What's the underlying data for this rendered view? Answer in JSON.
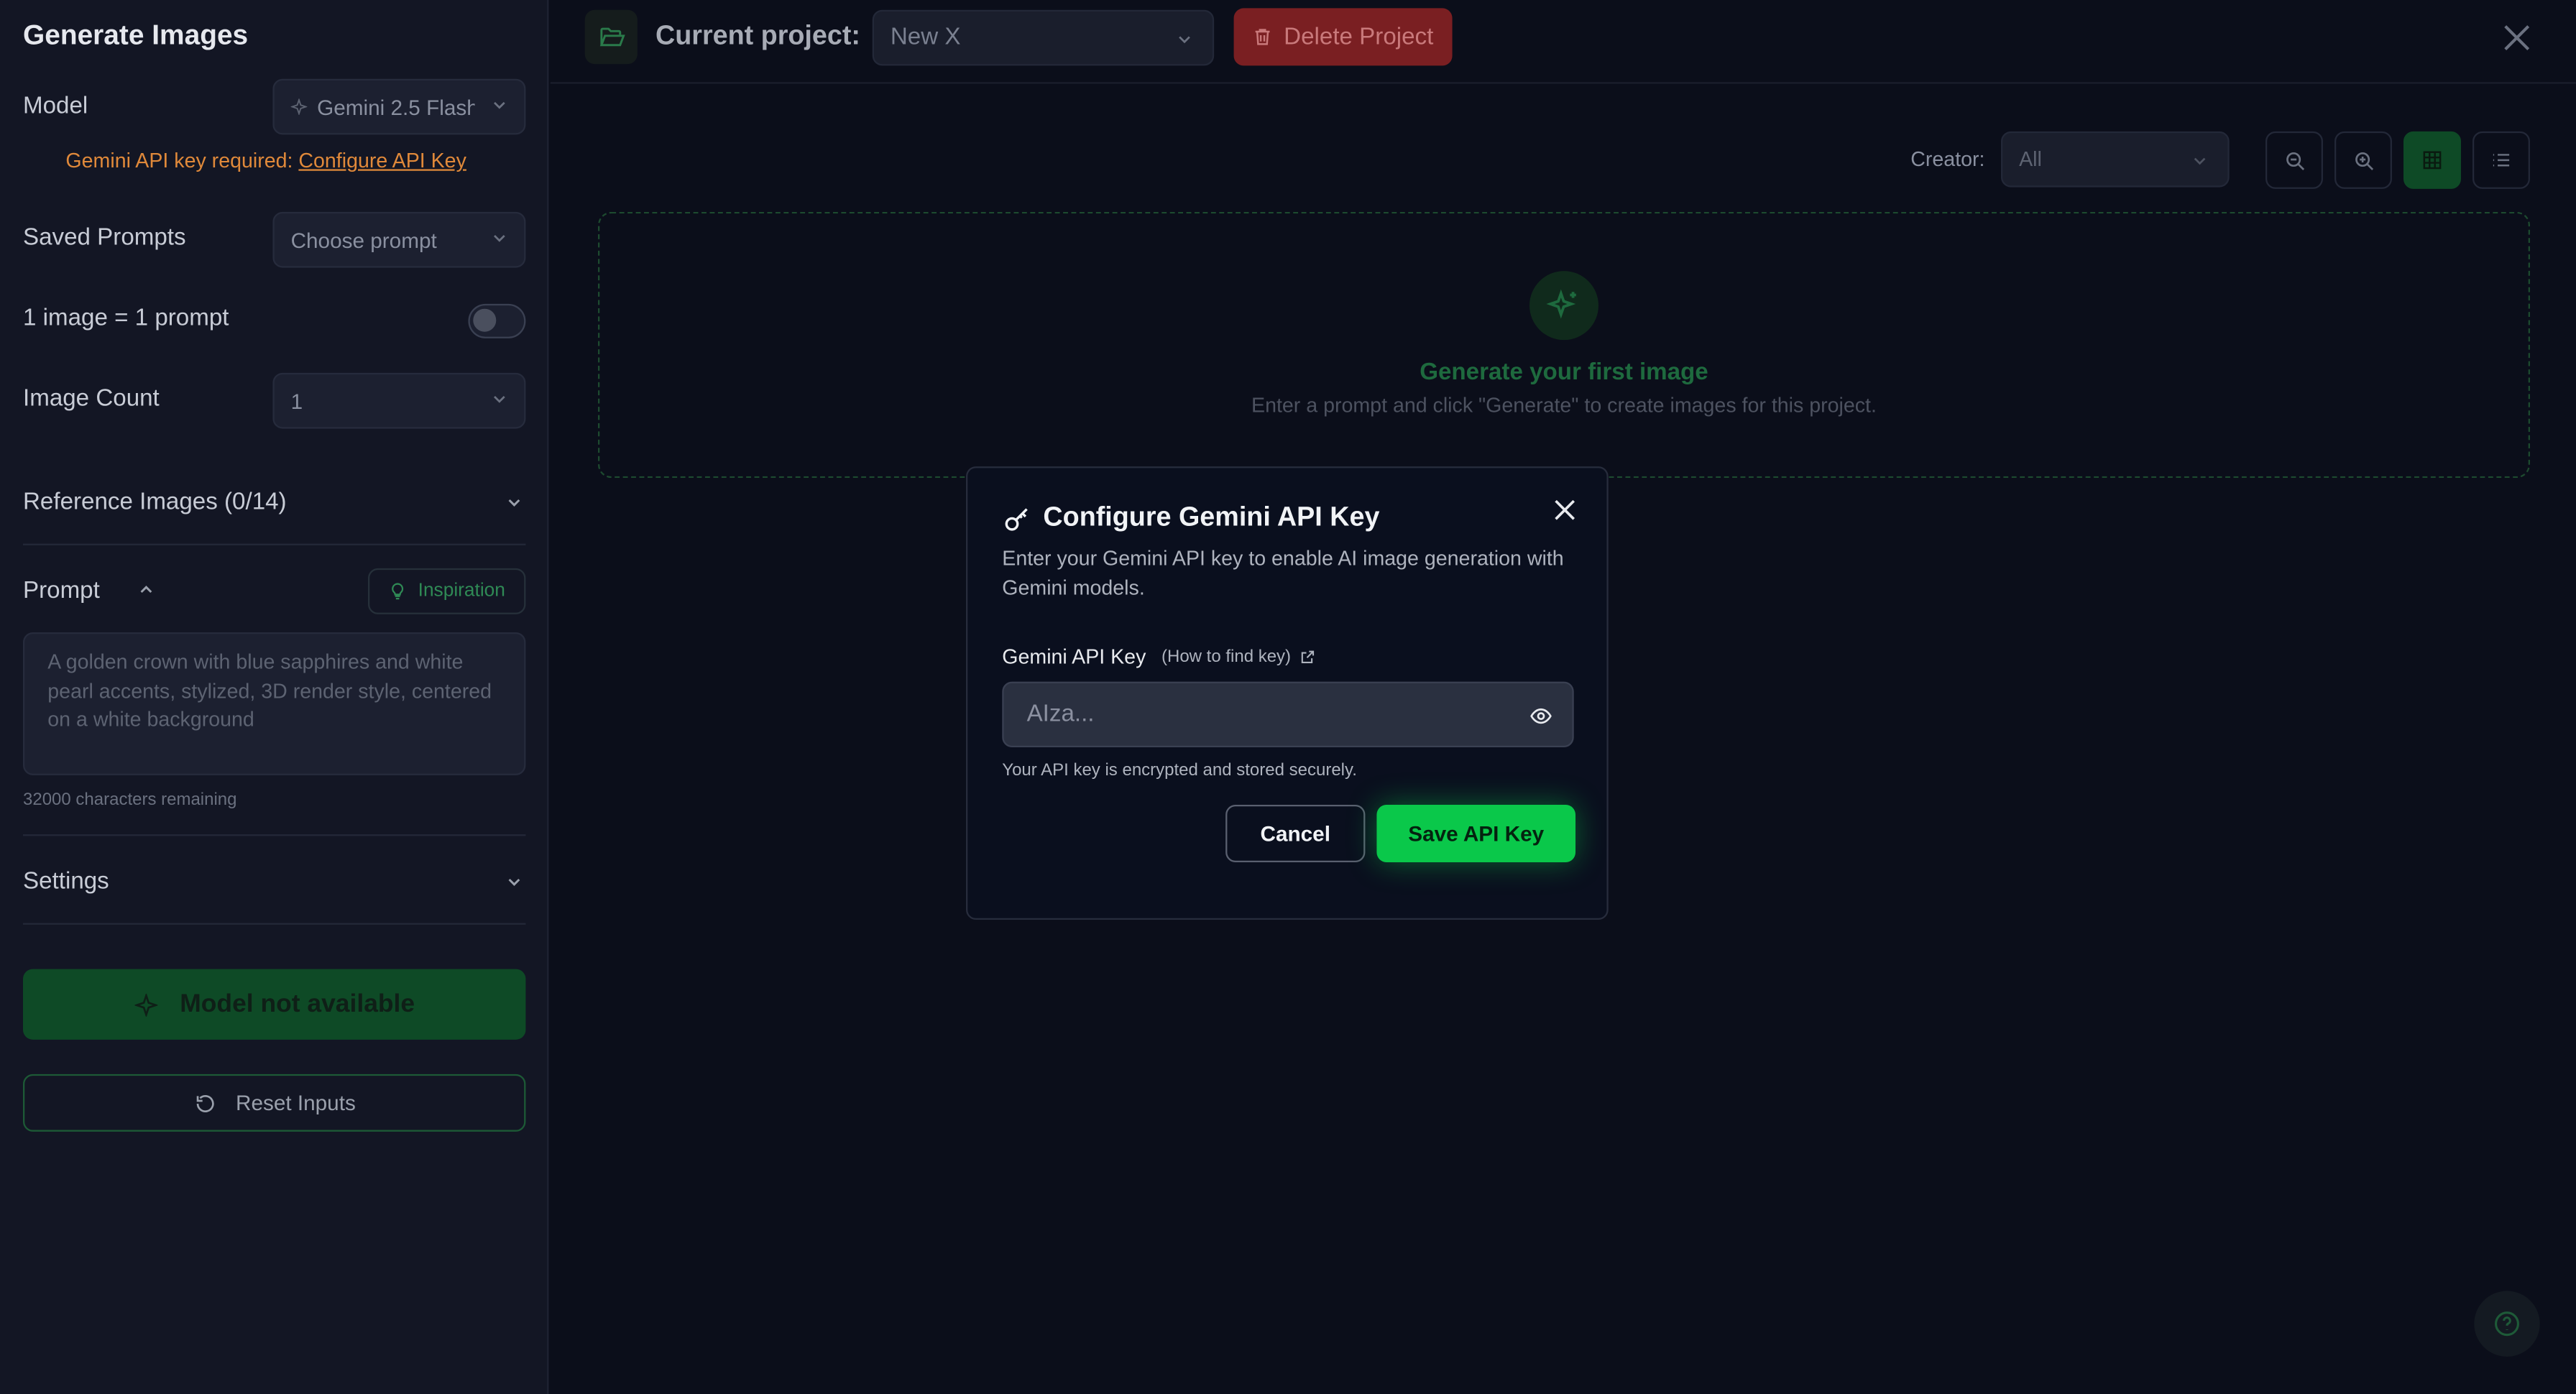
{
  "sidebar": {
    "title": "Generate Images",
    "model_label": "Model",
    "model_value": "Gemini 2.5 Flash",
    "warning_prefix": "Gemini API key required: ",
    "warning_link": "Configure API Key",
    "saved_prompts_label": "Saved Prompts",
    "saved_prompts_placeholder": "Choose prompt",
    "one_image_label": "1 image = 1 prompt",
    "image_count_label": "Image Count",
    "image_count_value": "1",
    "reference_images_label": "Reference Images (0/14)",
    "prompt_label": "Prompt",
    "inspiration_label": "Inspiration",
    "prompt_placeholder": "A golden crown with blue sapphires and white pearl accents, stylized, 3D render style, centered on a white background",
    "chars_remaining": "32000 characters remaining",
    "settings_label": "Settings",
    "generate_label": "Model not available",
    "reset_label": "Reset Inputs"
  },
  "header": {
    "current_project_label": "Current project:",
    "project_value": "New X",
    "delete_label": "Delete Project"
  },
  "toolbar": {
    "creator_label": "Creator:",
    "creator_value": "All"
  },
  "empty_state": {
    "title": "Generate your first image",
    "subtitle": "Enter a prompt and click \"Generate\" to create images for this project."
  },
  "modal": {
    "title": "Configure Gemini API Key",
    "description": "Enter your Gemini API key to enable AI image generation with Gemini models.",
    "field_label": "Gemini API Key",
    "field_hint": "(How to find key)",
    "input_placeholder": "AIza...",
    "secure_note": "Your API key is encrypted and stored securely.",
    "cancel_label": "Cancel",
    "save_label": "Save API Key"
  },
  "colors": {
    "accent": "#0ac84a",
    "danger": "#7a1f22",
    "warning": "#e0893a"
  }
}
